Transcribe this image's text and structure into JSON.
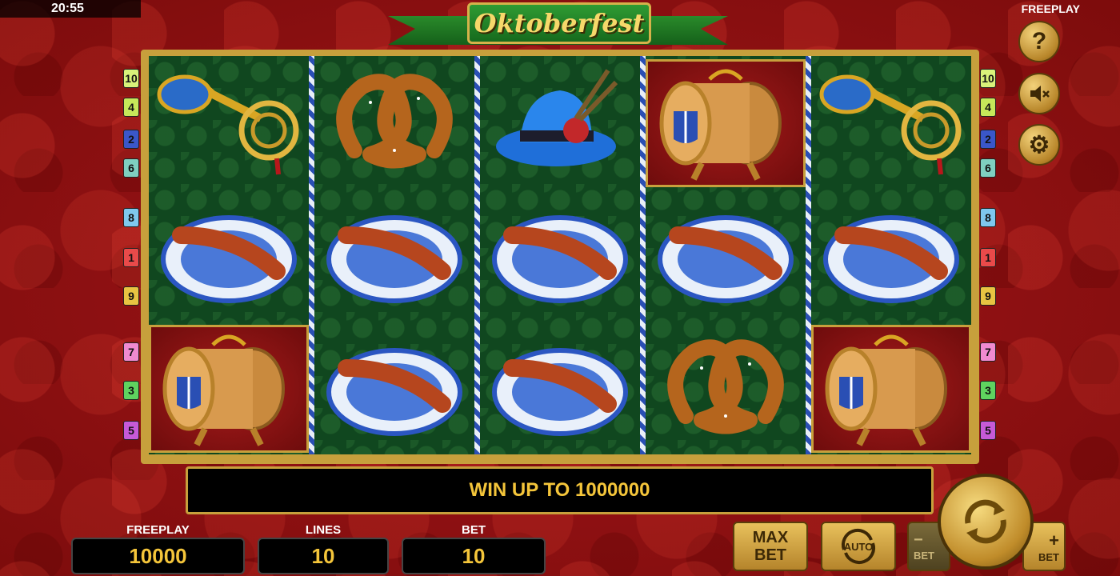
{
  "status_bar": {
    "time": "20:55",
    "mode": "FREEPLAY"
  },
  "title": "Oktoberfest",
  "side_buttons": [
    {
      "name": "help",
      "icon": "question-icon",
      "glyph": "?"
    },
    {
      "name": "sound",
      "icon": "mute-speaker-icon",
      "glyph": "🔈"
    },
    {
      "name": "settings",
      "icon": "gear-icon",
      "glyph": "⚙"
    }
  ],
  "paylines_left": [
    "10",
    "4",
    "2",
    "6",
    "8",
    "1",
    "9",
    "7",
    "3",
    "5"
  ],
  "paylines_right": [
    "10",
    "4",
    "2",
    "6",
    "8",
    "1",
    "9",
    "7",
    "3",
    "5"
  ],
  "payline_colors": [
    "#d9f27a",
    "#c6e85a",
    "#3a57c9",
    "#7fd0c0",
    "#7fc8ee",
    "#e94a4a",
    "#e8c442",
    "#f08ad0",
    "#5fd35f",
    "#c65ad8"
  ],
  "reels": [
    [
      "horn",
      "sausage",
      "barrel"
    ],
    [
      "pretzel",
      "sausage",
      "sausage"
    ],
    [
      "hat",
      "sausage",
      "sausage"
    ],
    [
      "barrel",
      "sausage",
      "pretzel"
    ],
    [
      "horn",
      "sausage",
      "barrel"
    ]
  ],
  "message": "WIN UP TO 1000000",
  "freeplay": {
    "label": "FREEPLAY",
    "value": "10000"
  },
  "lines": {
    "label": "LINES",
    "value": "10"
  },
  "bet": {
    "label": "BET",
    "value": "10"
  },
  "buttons": {
    "max_bet_top": "MAX",
    "max_bet_bottom": "BET",
    "auto": "AUTO",
    "bet_minus_sign": "−",
    "bet_minus_label": "BET",
    "bet_plus_sign": "+",
    "bet_plus_label": "BET"
  },
  "colors": {
    "gold": "#c7a03c",
    "win_text": "#f4c53a",
    "felt": "#10471f",
    "background": "#8e1010"
  }
}
